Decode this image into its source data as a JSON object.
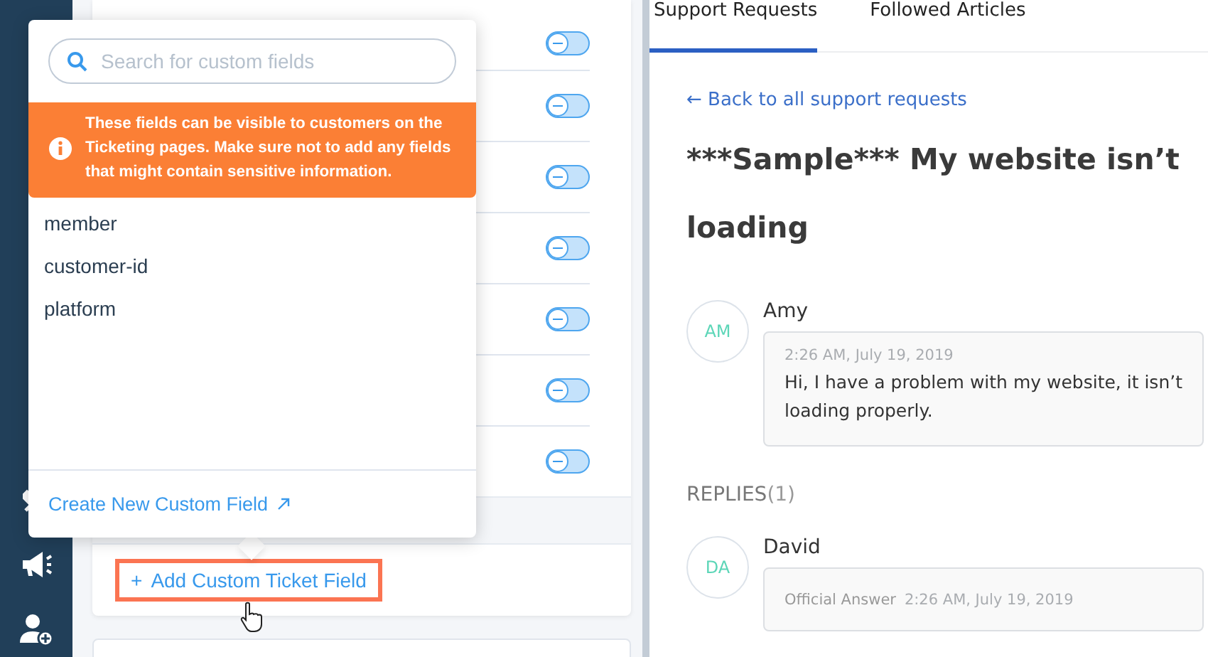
{
  "toggles": [
    {
      "on": false
    },
    {
      "on": false
    },
    {
      "on": false
    },
    {
      "on": false
    },
    {
      "on": false
    },
    {
      "on": false
    },
    {
      "on": false
    }
  ],
  "add_field_button": {
    "label": "Add Custom Ticket Field",
    "icon": "+"
  },
  "popup": {
    "search": {
      "placeholder": "Search for custom fields"
    },
    "warning": "These fields can be visible to customers on the Ticketing pages. Make sure not to add any fields that might contain sensitive information.",
    "fields": [
      "member",
      "customer-id",
      "platform"
    ],
    "create_link": "Create New Custom Field"
  },
  "tabs": [
    {
      "label": "Support Requests",
      "selected": true
    },
    {
      "label": "Followed Articles",
      "selected": false
    }
  ],
  "back_link": "← Back to all support requests",
  "title": "***Sample*** My website isn’t loading",
  "message": {
    "initials": "AM",
    "author": "Amy",
    "time": "2:26 AM, July 19, 2019",
    "text": "Hi, I have a problem with my website, it isn’t loading properly."
  },
  "replies": {
    "label": "REPLIES",
    "count": "(1)"
  },
  "reply": {
    "initials": "DA",
    "author": "David",
    "badge": "Official Answer",
    "time": "2:26 AM, July 19, 2019"
  }
}
